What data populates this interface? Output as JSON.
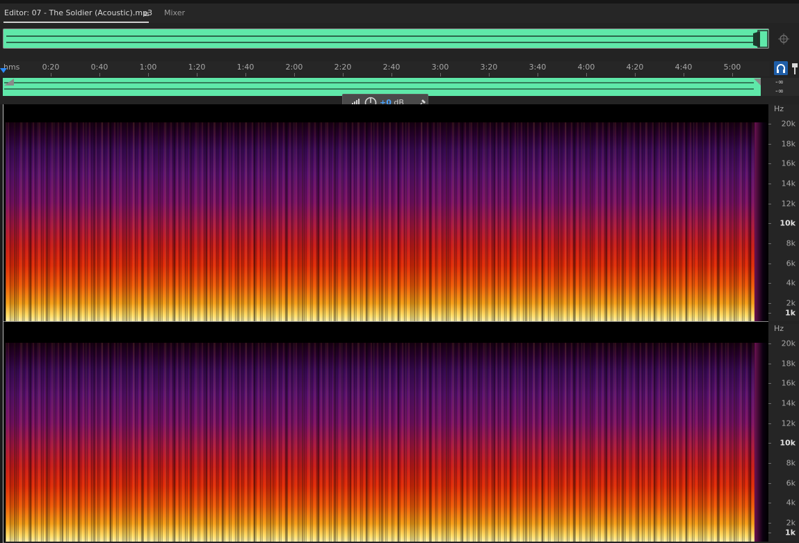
{
  "tabs": {
    "editor_label": "Editor: 07 - The Soldier (Acoustic).mp3",
    "mixer_label": "Mixer",
    "menu_icon": "menu-icon"
  },
  "ruler": {
    "first_label": "hms",
    "labels": [
      "0:20",
      "0:40",
      "1:00",
      "1:20",
      "1:40",
      "2:00",
      "2:20",
      "2:40",
      "3:00",
      "3:20",
      "3:40",
      "4:00",
      "4:20",
      "4:40",
      "5:00"
    ]
  },
  "track": {
    "level_top": "-∞",
    "level_bottom": "-∞"
  },
  "hud": {
    "db_value": "+0",
    "db_unit": "dB",
    "icons": [
      "level-meter-icon",
      "volume-knob-icon",
      "pin-icon"
    ]
  },
  "spectrogram": {
    "unit_label": "Hz",
    "freq_labels": [
      "20k",
      "18k",
      "16k",
      "14k",
      "12k",
      "10k",
      "8k",
      "6k",
      "4k",
      "2k",
      "1k"
    ],
    "bold_labels": [
      "10k",
      "1k"
    ]
  },
  "colors": {
    "waveform": "#5fe8a9",
    "playhead": "#2b8bff",
    "accent": "#4aa3ff"
  }
}
